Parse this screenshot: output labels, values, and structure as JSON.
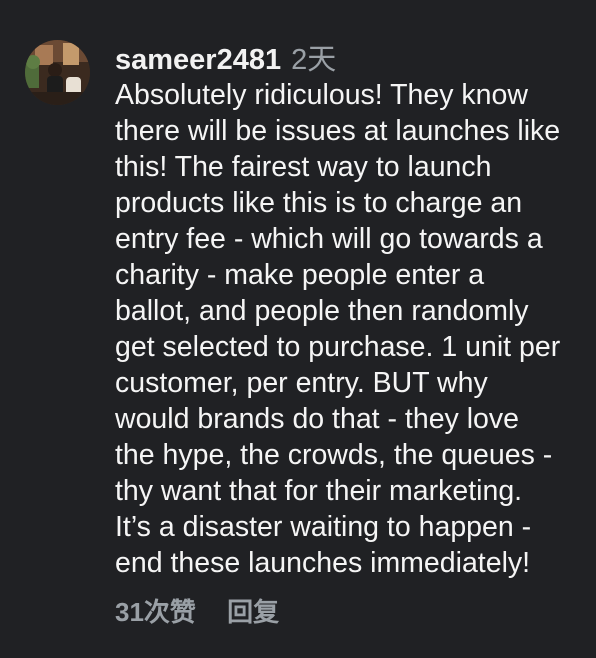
{
  "comment": {
    "username": "sameer2481",
    "timestamp": "2天",
    "text_lines": [
      "Absolutely ridiculous! They know",
      "there will be issues at launches like",
      "this! The fairest way to launch",
      "products like this is to charge an",
      "entry fee - which will go towards a",
      "charity - make people enter a",
      "ballot, and people then randomly",
      "get selected to purchase. 1 unit per",
      "customer, per entry. BUT why",
      "would brands do that - they love",
      "the hype, the crowds, the queues -",
      "thy want that for their marketing.",
      "It’s a disaster waiting to happen -",
      "end these launches immediately!"
    ],
    "likes_label": "31次赞",
    "reply_label": "回复"
  },
  "colors": {
    "background": "#202124",
    "text": "#f5f5f5",
    "muted": "#9aa0a6"
  },
  "icons": {
    "avatar": "user-avatar-photo"
  }
}
